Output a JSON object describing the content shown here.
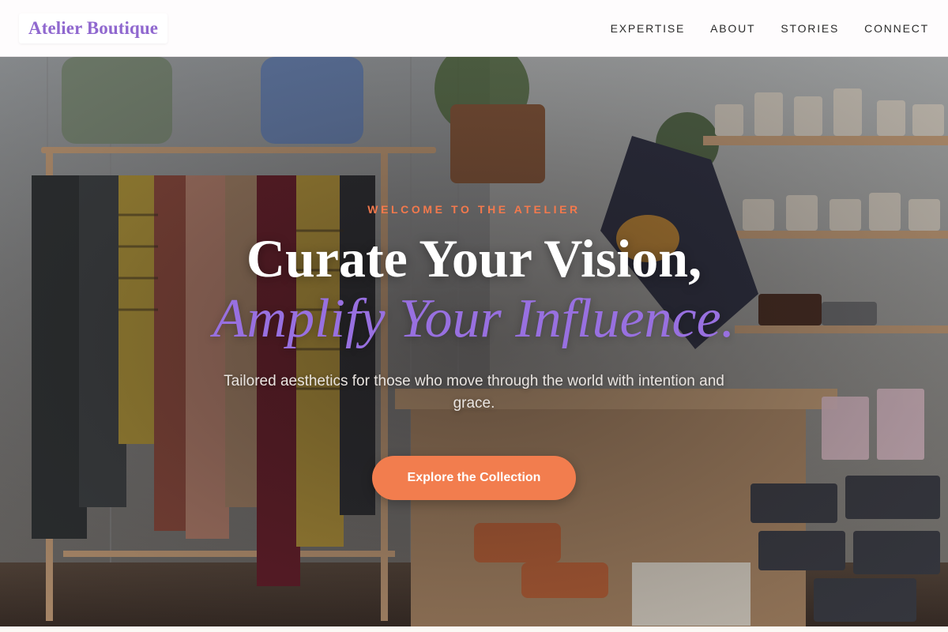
{
  "brand": {
    "name": "Atelier Boutique",
    "color": "#9068cf"
  },
  "nav": {
    "items": [
      {
        "label": "EXPERTISE"
      },
      {
        "label": "ABOUT"
      },
      {
        "label": "STORIES"
      },
      {
        "label": "CONNECT"
      }
    ]
  },
  "hero": {
    "eyebrow": "WELCOME TO THE ATELIER",
    "headline_line1": "Curate Your Vision,",
    "headline_line2": "Amplify Your Influence.",
    "subtext": "Tailored aesthetics for those who move through the world with intention and grace.",
    "cta_label": "Explore the Collection",
    "background_image": "boutique-interior-photo"
  },
  "colors": {
    "accent_orange": "#f27d4e",
    "accent_purple": "#9870e0",
    "header_bg": "#fefcfd"
  }
}
